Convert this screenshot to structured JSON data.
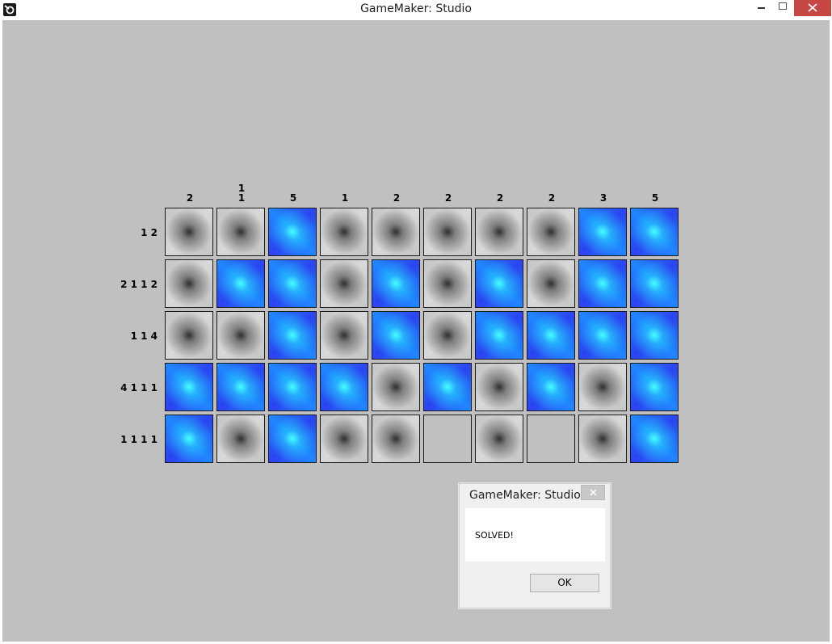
{
  "window": {
    "title": "GameMaker: Studio",
    "colors": {
      "close_button": "#c74745",
      "room_background": "#c0c0c0"
    }
  },
  "puzzle": {
    "column_clues": [
      [
        "2"
      ],
      [
        "1",
        "1"
      ],
      [
        "5"
      ],
      [
        "1"
      ],
      [
        "2"
      ],
      [
        "2"
      ],
      [
        "2"
      ],
      [
        "2"
      ],
      [
        "3"
      ],
      [
        "5"
      ]
    ],
    "row_clues": [
      "1 2",
      "2 1 1 2",
      "1 1 4",
      "4 1 1 1",
      "1 1 1 1"
    ],
    "grid": [
      [
        "x",
        "x",
        "f",
        "x",
        "x",
        "x",
        "x",
        "x",
        "f",
        "f"
      ],
      [
        "x",
        "f",
        "f",
        "x",
        "f",
        "x",
        "f",
        "x",
        "f",
        "f"
      ],
      [
        "x",
        "x",
        "f",
        "x",
        "f",
        "x",
        "f",
        "f",
        "f",
        "f"
      ],
      [
        "f",
        "f",
        "f",
        "f",
        "x",
        "f",
        "x",
        "f",
        "x",
        "f"
      ],
      [
        "f",
        "x",
        "f",
        "x",
        "x",
        "b",
        "x",
        "b",
        "x",
        "f"
      ]
    ],
    "legend": {
      "f": "filled",
      "x": "marked-empty",
      "b": "blank"
    },
    "colors": {
      "filled": "#2b45f0",
      "filled_center": "#46ffff",
      "empty": "#d0d0d0",
      "empty_center": "#282828"
    }
  },
  "dialog": {
    "title": "GameMaker: Studio",
    "message": "SOLVED!",
    "ok_label": "OK",
    "close_icon": "close-icon"
  }
}
